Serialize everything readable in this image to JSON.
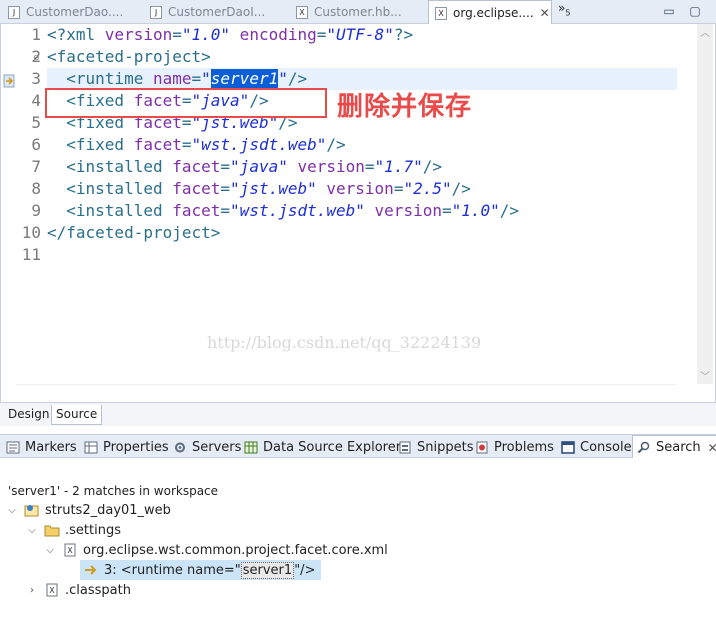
{
  "editor_tabs": [
    {
      "label": "CustomerDao....",
      "icon": "java-file-icon"
    },
    {
      "label": "CustomerDaoI...",
      "icon": "java-file-icon"
    },
    {
      "label": "Customer.hb...",
      "icon": "xml-file-icon"
    },
    {
      "label": "org.eclipse....",
      "icon": "xml-file-icon",
      "active": true
    }
  ],
  "overflow_count": "5",
  "code_lines": [
    {
      "n": "1"
    },
    {
      "n": "2"
    },
    {
      "n": "3"
    },
    {
      "n": "4"
    },
    {
      "n": "5"
    },
    {
      "n": "6"
    },
    {
      "n": "7"
    },
    {
      "n": "8"
    },
    {
      "n": "9"
    },
    {
      "n": "10"
    },
    {
      "n": "11"
    }
  ],
  "code": {
    "l1": {
      "open": "<?xml ",
      "a1": "version",
      "eq1": "=",
      "v1": "\"1.0\"",
      "a2": " encoding",
      "eq2": "=",
      "v2": "\"UTF-8\"",
      "close": "?>"
    },
    "l2": {
      "text": "<faceted-project>"
    },
    "l3": {
      "open": "  <runtime ",
      "a1": "name",
      "eq1": "=",
      "q1": "\"",
      "sel": "server1",
      "q2": "\"",
      "close": "/>"
    },
    "l4": {
      "open": "  <fixed ",
      "a1": "facet",
      "eq1": "=",
      "v1": "\"java\"",
      "close": "/>"
    },
    "l5": {
      "open": "  <fixed ",
      "a1": "facet",
      "eq1": "=",
      "v1": "\"jst.web\"",
      "close": "/>"
    },
    "l6": {
      "open": "  <fixed ",
      "a1": "facet",
      "eq1": "=",
      "v1": "\"wst.jsdt.web\"",
      "close": "/>"
    },
    "l7": {
      "open": "  <installed ",
      "a1": "facet",
      "eq1": "=",
      "v1": "\"java\"",
      "a2": " version",
      "eq2": "=",
      "v2": "\"1.7\"",
      "close": "/>"
    },
    "l8": {
      "open": "  <installed ",
      "a1": "facet",
      "eq1": "=",
      "v1": "\"jst.web\"",
      "a2": " version",
      "eq2": "=",
      "v2": "\"2.5\"",
      "close": "/>"
    },
    "l9": {
      "open": "  <installed ",
      "a1": "facet",
      "eq1": "=",
      "v1": "\"wst.jsdt.web\"",
      "a2": " version",
      "eq2": "=",
      "v2": "\"1.0\"",
      "close": "/>"
    },
    "l10": {
      "text": "</faceted-project>"
    }
  },
  "annotation": "删除并保存",
  "watermark": "http://blog.csdn.net/qq_32224139",
  "design_tabs": {
    "design": "Design",
    "source": "Source"
  },
  "view_tabs": [
    {
      "label": "Markers",
      "icon": "markers-icon"
    },
    {
      "label": "Properties",
      "icon": "properties-icon"
    },
    {
      "label": "Servers",
      "icon": "servers-icon"
    },
    {
      "label": "Data Source Explorer",
      "icon": "data-source-icon"
    },
    {
      "label": "Snippets",
      "icon": "snippets-icon"
    },
    {
      "label": "Problems",
      "icon": "problems-icon"
    },
    {
      "label": "Console",
      "icon": "console-icon"
    },
    {
      "label": "Search",
      "icon": "search-icon",
      "active": true
    }
  ],
  "search": {
    "summary": "'server1' - 2 matches in workspace",
    "project": "struts2_day01_web",
    "folder": ".settings",
    "file": "org.eclipse.wst.common.project.facet.core.xml",
    "match_prefix": "3: <runtime name=\"",
    "match_term": "server1",
    "match_suffix": "\"/>",
    "file2": ".classpath"
  },
  "colors": {
    "annotation": "#e94b4b",
    "selection": "#0a5fd8",
    "tag": "#2a6f8c",
    "attr": "#7f2fa8",
    "string": "#1d2fd6"
  }
}
